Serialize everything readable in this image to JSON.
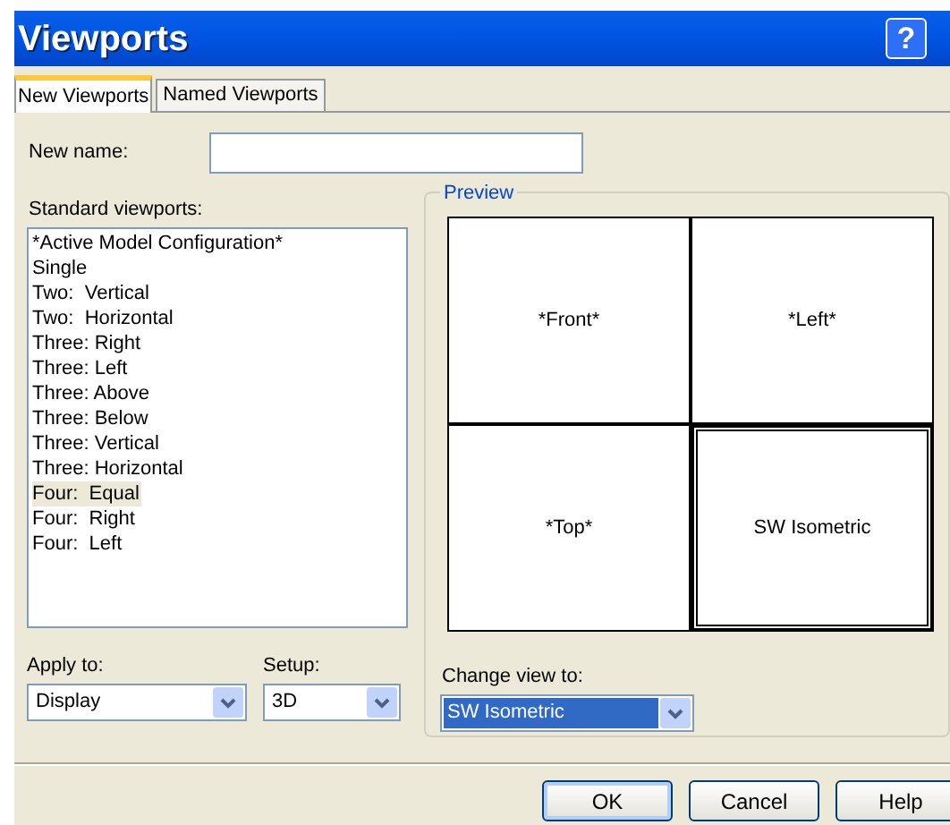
{
  "window": {
    "title": "Viewports",
    "help_button": "?"
  },
  "tabs": [
    {
      "label": "New Viewports",
      "selected": true
    },
    {
      "label": "Named Viewports",
      "selected": false
    }
  ],
  "new_name": {
    "label": "New name:"
  },
  "standard_viewports": {
    "label": "Standard viewports:",
    "items": [
      {
        "label": "*Active Model Configuration*",
        "selected": false
      },
      {
        "label": "Single",
        "selected": false
      },
      {
        "label": "Two:  Vertical",
        "selected": false
      },
      {
        "label": "Two:  Horizontal",
        "selected": false
      },
      {
        "label": "Three: Right",
        "selected": false
      },
      {
        "label": "Three: Left",
        "selected": false
      },
      {
        "label": "Three: Above",
        "selected": false
      },
      {
        "label": "Three: Below",
        "selected": false
      },
      {
        "label": "Three: Vertical",
        "selected": false
      },
      {
        "label": "Three: Horizontal",
        "selected": false
      },
      {
        "label": "Four:  Equal",
        "selected": true
      },
      {
        "label": "Four:  Right",
        "selected": false
      },
      {
        "label": "Four:  Left",
        "selected": false
      }
    ]
  },
  "preview": {
    "title": "Preview",
    "viewports": [
      {
        "label": "*Front*",
        "selected": false
      },
      {
        "label": "*Left*",
        "selected": false
      },
      {
        "label": "*Top*",
        "selected": false
      },
      {
        "label": "SW Isometric",
        "selected": true
      }
    ]
  },
  "apply_to": {
    "label": "Apply to:",
    "value": "Display"
  },
  "setup": {
    "label": "Setup:",
    "value": "3D"
  },
  "change_view": {
    "label": "Change view to:",
    "value": "SW Isometric",
    "selected": true
  },
  "buttons": [
    "OK",
    "Cancel",
    "Help"
  ]
}
